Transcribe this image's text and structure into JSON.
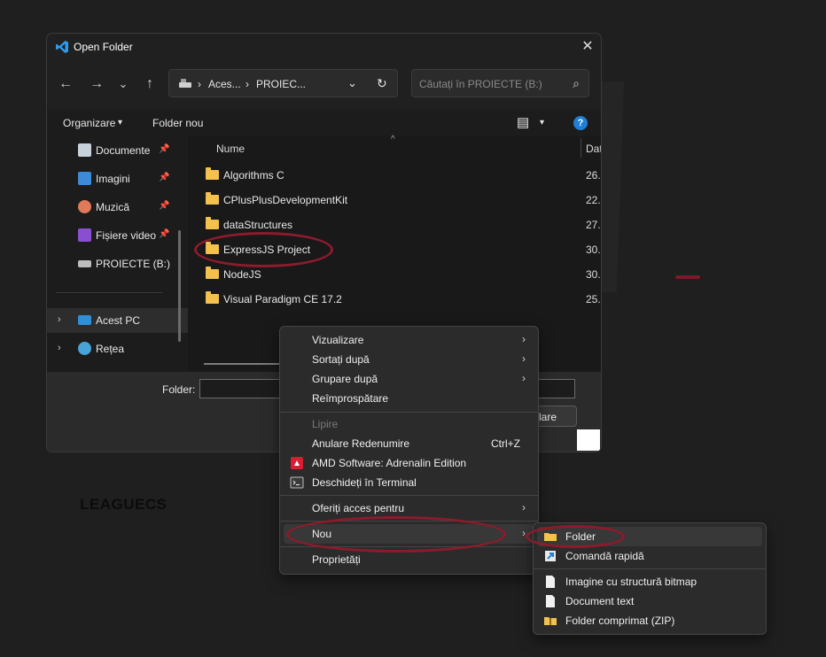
{
  "dialog": {
    "title": "Open Folder",
    "close_glyph": "✕",
    "nav": {
      "back": "←",
      "forward": "→",
      "recent": "⌄",
      "up": "↑"
    },
    "address": {
      "seg1": "Aces...",
      "seg2": "PROIEC...",
      "sep": "›",
      "dropdown": "⌄",
      "refresh": "↻"
    },
    "search": {
      "placeholder": "Căutați în PROIECTE (B:)",
      "icon": "⌕"
    },
    "commands": {
      "organize": "Organizare",
      "new_folder": "Folder nou",
      "view_glyph": "▤",
      "caret": "▾",
      "help": "?"
    },
    "sidebar": {
      "items": [
        {
          "label": "Documente",
          "icon": "documents-icon",
          "pinned": true
        },
        {
          "label": "Imagini",
          "icon": "pictures-icon",
          "pinned": true
        },
        {
          "label": "Muzică",
          "icon": "music-icon",
          "pinned": true
        },
        {
          "label": "Fișiere video",
          "icon": "videos-icon",
          "pinned": true
        },
        {
          "label": "PROIECTE (B:)",
          "icon": "drive-icon",
          "pinned": false
        },
        {
          "label": "Acest PC",
          "icon": "this-pc-icon",
          "selected": true
        },
        {
          "label": "Rețea",
          "icon": "network-icon"
        }
      ],
      "pin_glyph": "📌",
      "expand_glyph": "›"
    },
    "columns": {
      "name": "Nume",
      "date": "Dat",
      "sort_glyph": "^"
    },
    "files": [
      {
        "name": "Algorithms C",
        "date": "26."
      },
      {
        "name": "CPlusPlusDevelopmentKit",
        "date": "22."
      },
      {
        "name": "dataStructures",
        "date": "27."
      },
      {
        "name": "ExpressJS Project",
        "date": "30."
      },
      {
        "name": "NodeJS",
        "date": "30."
      },
      {
        "name": "Visual Paradigm CE 17.2",
        "date": "25."
      }
    ],
    "footer": {
      "folder_label": "Folder:",
      "folder_value": "",
      "select_button": "lare"
    }
  },
  "background": {
    "text": "LEAGUECS"
  },
  "context_menu": {
    "items": [
      {
        "label": "Vizualizare",
        "submenu": true
      },
      {
        "label": "Sortați după",
        "submenu": true
      },
      {
        "label": "Grupare după",
        "submenu": true
      },
      {
        "label": "Reîmprospătare"
      },
      {
        "label": "Lipire",
        "disabled": true
      },
      {
        "label": "Anulare Redenumire",
        "shortcut": "Ctrl+Z"
      },
      {
        "label": "AMD Software: Adrenalin Edition",
        "icon": "amd-icon"
      },
      {
        "label": "Deschideți în Terminal",
        "icon": "terminal-icon"
      },
      {
        "label": "Oferiți acces pentru",
        "submenu": true
      },
      {
        "label": "Nou",
        "submenu": true,
        "highlighted": true
      },
      {
        "label": "Proprietăți"
      }
    ],
    "arrow_glyph": "›"
  },
  "submenu_new": {
    "items": [
      {
        "label": "Folder",
        "icon": "folder-icon",
        "highlighted": true
      },
      {
        "label": "Comandă rapidă",
        "icon": "shortcut-icon"
      },
      {
        "label": "Imagine cu structură bitmap",
        "icon": "file-icon"
      },
      {
        "label": "Document text",
        "icon": "file-icon"
      },
      {
        "label": "Folder comprimat (ZIP)",
        "icon": "zip-folder-icon"
      }
    ]
  },
  "colors": {
    "accent_ring": "#8c1b2c",
    "folder": "#f2c14e",
    "help": "#1f7fd6"
  }
}
